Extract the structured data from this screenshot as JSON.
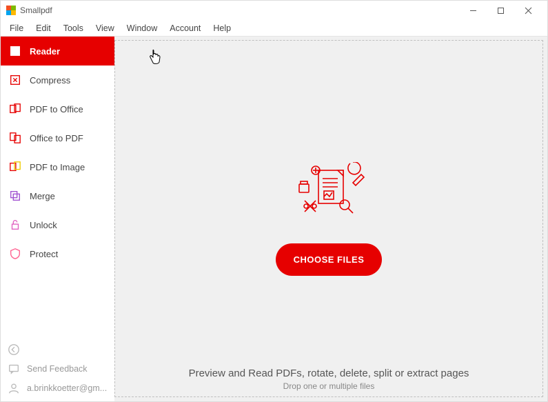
{
  "titlebar": {
    "appName": "Smallpdf"
  },
  "menu": {
    "items": [
      "File",
      "Edit",
      "Tools",
      "View",
      "Window",
      "Account",
      "Help"
    ]
  },
  "sidebar": {
    "items": [
      {
        "label": "Reader",
        "icon": "reader-icon",
        "active": true
      },
      {
        "label": "Compress",
        "icon": "compress-icon",
        "active": false
      },
      {
        "label": "PDF to Office",
        "icon": "pdf-to-office-icon",
        "active": false
      },
      {
        "label": "Office to PDF",
        "icon": "office-to-pdf-icon",
        "active": false
      },
      {
        "label": "PDF to Image",
        "icon": "pdf-to-image-icon",
        "active": false
      },
      {
        "label": "Merge",
        "icon": "merge-icon",
        "active": false
      },
      {
        "label": "Unlock",
        "icon": "unlock-icon",
        "active": false
      },
      {
        "label": "Protect",
        "icon": "protect-icon",
        "active": false
      }
    ],
    "backLabel": "",
    "feedbackLabel": "Send Feedback",
    "accountEmail": "a.brinkkoetter@gm..."
  },
  "main": {
    "chooseLabel": "CHOOSE FILES",
    "infoTitle": "Preview and Read PDFs, rotate, delete, split or extract pages",
    "infoSubtitle": "Drop one or multiple files"
  },
  "colors": {
    "accent": "#e60000"
  }
}
